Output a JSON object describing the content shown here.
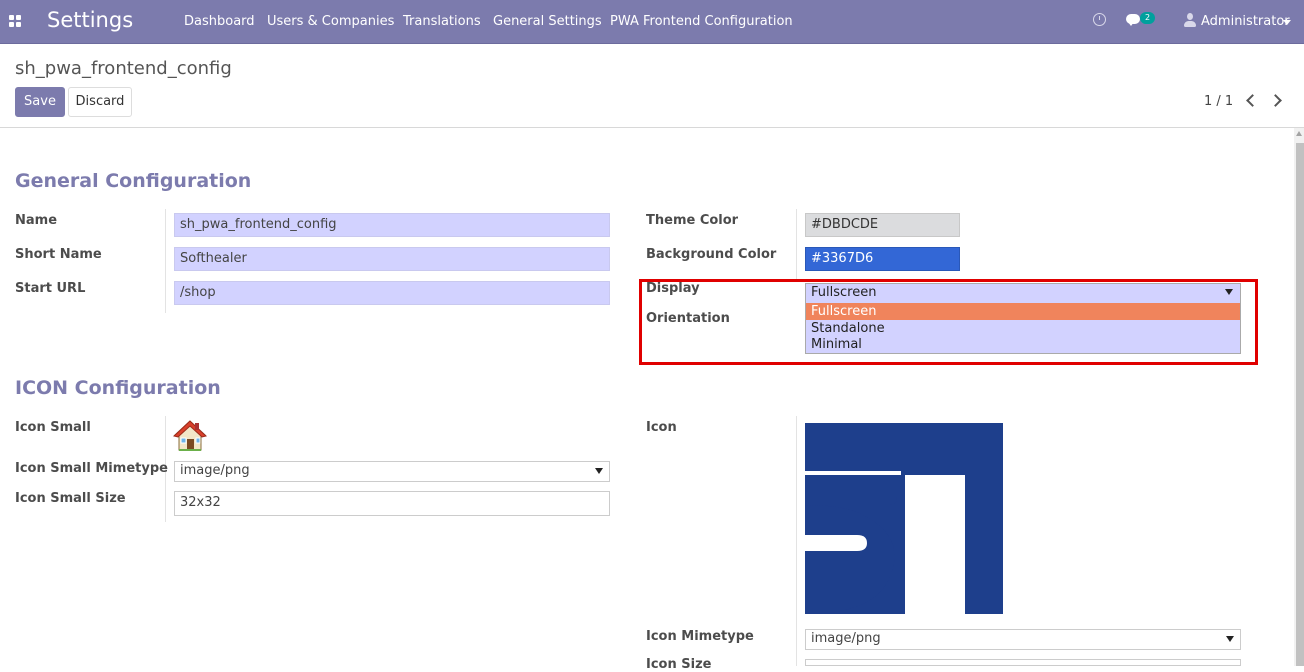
{
  "app": {
    "title": "Settings",
    "menu": [
      "Dashboard",
      "Users & Companies",
      "Translations",
      "General Settings",
      "PWA Frontend Configuration"
    ],
    "chat_badge": "2",
    "user": "Administrator"
  },
  "control_panel": {
    "breadcrumb": "sh_pwa_frontend_config",
    "save_label": "Save",
    "discard_label": "Discard",
    "pager": "1 / 1"
  },
  "general": {
    "title": "General Configuration",
    "name_label": "Name",
    "name_value": "sh_pwa_frontend_config",
    "short_name_label": "Short Name",
    "short_name_value": "Softhealer",
    "start_url_label": "Start URL",
    "start_url_value": "/shop",
    "theme_color_label": "Theme Color",
    "theme_color_value": "#DBDCDE",
    "background_color_label": "Background Color",
    "background_color_value": "#3367D6",
    "display_label": "Display",
    "display_value": "Fullscreen",
    "display_options": [
      "Fullscreen",
      "Standalone",
      "Minimal"
    ],
    "orientation_label": "Orientation"
  },
  "icon": {
    "title": "ICON Configuration",
    "icon_small_label": "Icon Small",
    "icon_small_mimetype_label": "Icon Small Mimetype",
    "icon_small_mimetype_value": "image/png",
    "icon_small_size_label": "Icon Small Size",
    "icon_small_size_value": "32x32",
    "icon_label": "Icon",
    "icon_mimetype_label": "Icon Mimetype",
    "icon_mimetype_value": "image/png",
    "icon_size_label": "Icon Size",
    "logo_text": "SH"
  },
  "colors": {
    "navbar": "#7c7bad",
    "accent": "#7c7bad",
    "theme_swatch": "#DBDCDE",
    "background_swatch": "#3367D6",
    "logo_blue": "#1e3f8c",
    "highlight": "#e00000"
  }
}
